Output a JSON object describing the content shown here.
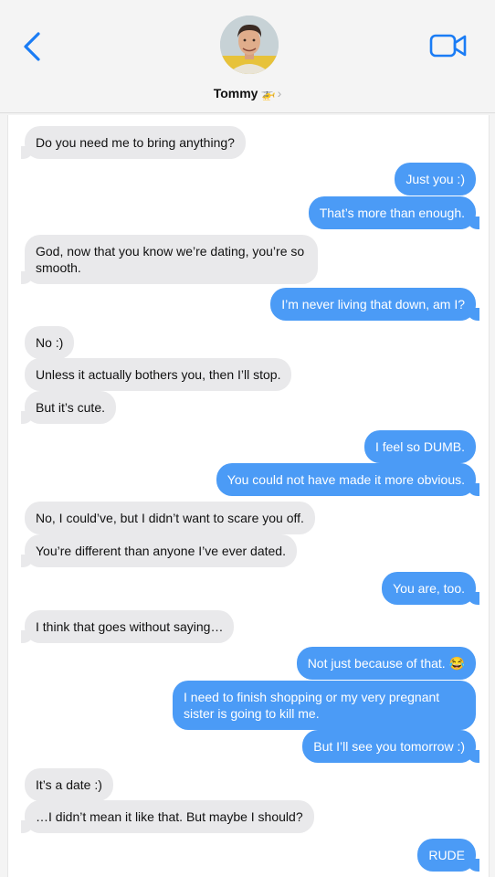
{
  "header": {
    "contact_name": "Tommy",
    "contact_emoji": "🚁",
    "chevron": "›",
    "icons": {
      "back": "chevron-left-icon",
      "video": "video-camera-icon"
    },
    "accent_color": "#1a7cf5"
  },
  "messages": [
    {
      "from": "them",
      "text": "Do you need me to bring anything?"
    },
    {
      "from": "me",
      "text": "Just you :)"
    },
    {
      "from": "me",
      "text": "That’s more than enough."
    },
    {
      "from": "them",
      "text": "God, now that you know we’re dating, you’re so smooth."
    },
    {
      "from": "me",
      "text": "I’m never living that down, am I?"
    },
    {
      "from": "them",
      "text": "No :)"
    },
    {
      "from": "them",
      "text": "Unless it actually bothers you, then I’ll stop."
    },
    {
      "from": "them",
      "text": "But it’s cute."
    },
    {
      "from": "me",
      "text": "I feel so DUMB."
    },
    {
      "from": "me",
      "text": "You could not have made it more obvious."
    },
    {
      "from": "them",
      "text": "No, I could’ve, but I didn’t want to scare you off."
    },
    {
      "from": "them",
      "text": "You’re different than anyone I’ve ever dated."
    },
    {
      "from": "me",
      "text": "You are, too."
    },
    {
      "from": "them",
      "text": "I think that goes without saying…"
    },
    {
      "from": "me",
      "text": "Not just because of that. 😂"
    },
    {
      "from": "me",
      "text": "I need to finish shopping or my very pregnant sister is going to kill me."
    },
    {
      "from": "me",
      "text": "But I’ll see you tomorrow :)"
    },
    {
      "from": "them",
      "text": "It’s a date :)"
    },
    {
      "from": "them",
      "text": "…I didn’t mean it like that. But maybe I should?"
    },
    {
      "from": "me",
      "text": "RUDE"
    }
  ],
  "colors": {
    "incoming_bubble": "#e9e9eb",
    "outgoing_bubble": "#4b9bf6"
  }
}
